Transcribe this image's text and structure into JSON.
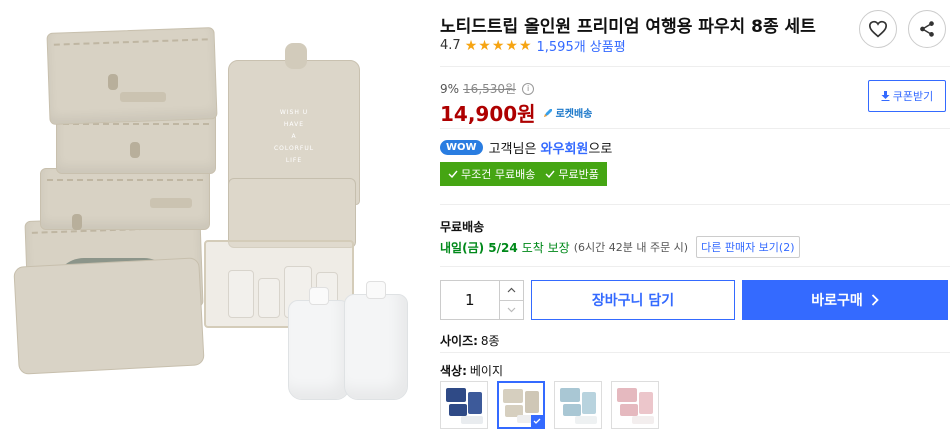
{
  "product": {
    "title": "노티드트립 올인원 프리미엄 여행용 파우치 8종 세트",
    "rating": "4.7",
    "review_count": "1,595개 상품평",
    "stars_filled": 5,
    "image_print": [
      "WISH U",
      "HAVE",
      "A",
      "COLORFUL",
      "LIFE"
    ]
  },
  "price": {
    "discount_rate": "9%",
    "original": "16,530원",
    "sale": "14,900원",
    "rocket_label": "로켓배송",
    "coupon_label": "쿠폰받기"
  },
  "wow": {
    "badge": "WOW",
    "prefix": "고객님은",
    "member": "와우회원",
    "suffix": "으로"
  },
  "free_tags": [
    "무조건 무료배송",
    "무료반품"
  ],
  "shipping": {
    "label": "무료배송",
    "date": "내일(금) 5/24",
    "guarantee": "도착 보장",
    "note": "(6시간 42분 내 주문 시)",
    "other_sellers": "다른 판매자 보기(2)"
  },
  "purchase": {
    "quantity": "1",
    "cart_label": "장바구니 담기",
    "buy_label": "바로구매"
  },
  "options": {
    "size_label": "사이즈:",
    "size_value": "8종",
    "color_label": "색상:",
    "color_value": "베이지",
    "swatch_colors": [
      "#2f4a86",
      "#d6cfbf",
      "#a9c7d4",
      "#e5b9bf"
    ],
    "selected_index": 1
  },
  "colors": {
    "accent": "#346aff",
    "price_red": "#ae0000",
    "free_green": "#45a513",
    "ship_green": "#00891a",
    "star": "#f6a412"
  }
}
